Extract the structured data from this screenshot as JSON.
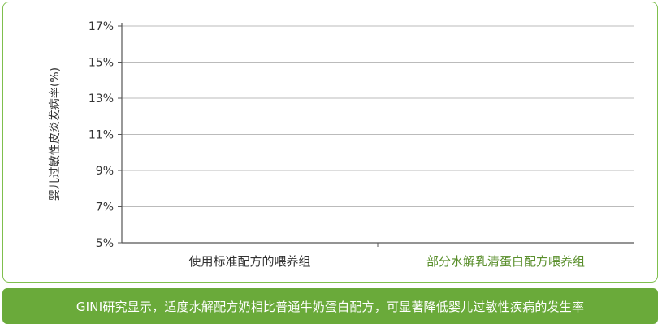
{
  "chart_data": {
    "type": "bar",
    "ylabel": "婴儿过敏性皮炎发病率(%)",
    "yticks": [
      "17%",
      "15%",
      "13%",
      "11%",
      "9%",
      "7%",
      "5%"
    ],
    "ytick_values": [
      17,
      15,
      13,
      11,
      9,
      7,
      5
    ],
    "ylim": [
      5,
      17
    ],
    "grid": true,
    "categories": [
      "使用标准配方的喂养组",
      "部分水解乳清蛋白配方喂养组"
    ],
    "category_colors": [
      "#333333",
      "#5a8f2c"
    ],
    "values": [
      null,
      null
    ]
  },
  "caption": "GINI研究显示，适度水解配方奶相比普通牛奶蛋白配方，可显著降低婴儿过敏性疾病的发生率",
  "colors": {
    "frame": "#7fbf4d",
    "caption_bg": "#6aaa3a",
    "grid": "#bbbbbb",
    "axis": "#555555"
  }
}
